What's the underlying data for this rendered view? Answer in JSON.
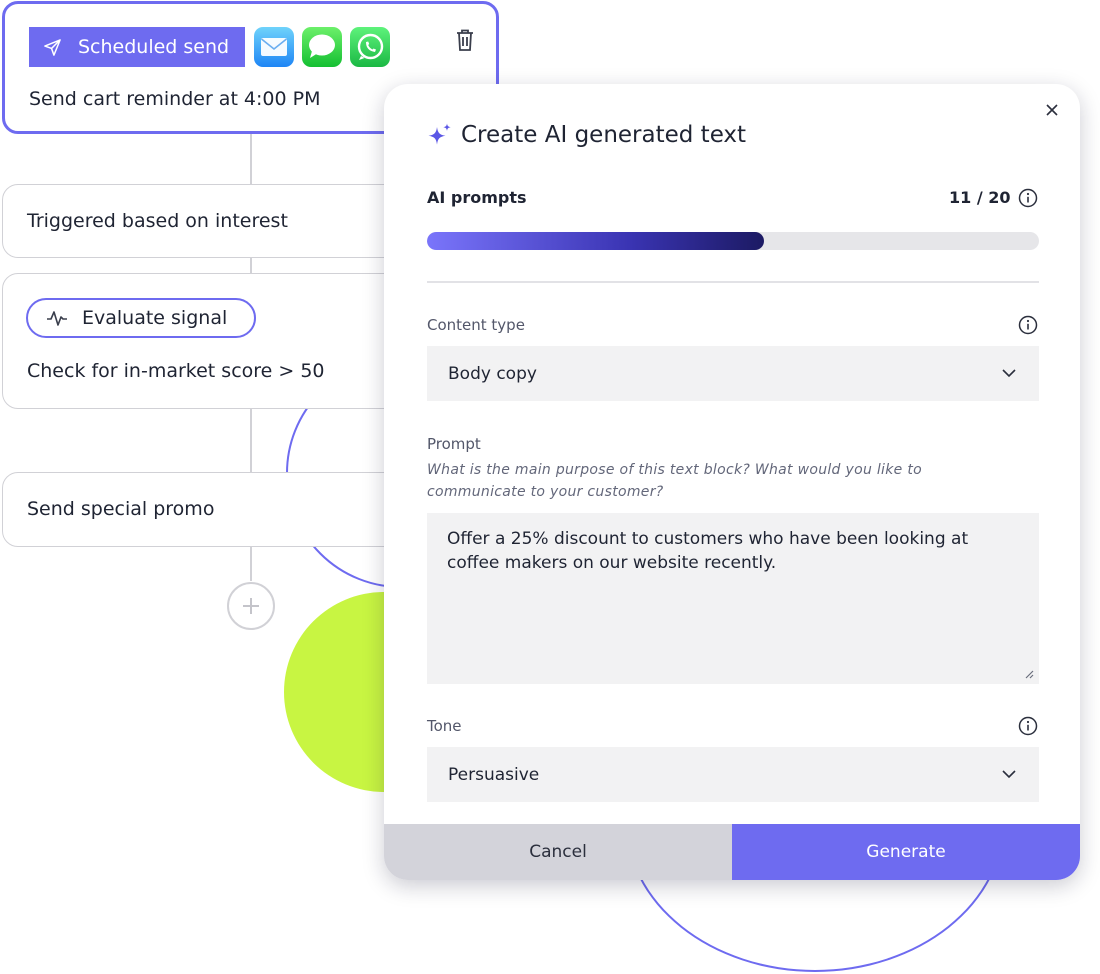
{
  "workflow": {
    "scheduled": {
      "chip_label": "Scheduled send",
      "text": "Send cart reminder at 4:00 PM",
      "channels": [
        "mail-icon",
        "messages-icon",
        "whatsapp-icon"
      ]
    },
    "triggered": {
      "text": "Triggered based on interest"
    },
    "evaluate": {
      "chip_label": "Evaluate signal",
      "text": "Check for in-market score > 50"
    },
    "promo": {
      "text": "Send special promo"
    },
    "add_step_icon": "plus-icon"
  },
  "modal": {
    "title": "Create AI generated text",
    "title_icon": "sparkle-icon",
    "prompts": {
      "label": "AI prompts",
      "count_text": "11 / 20",
      "used": 11,
      "total": 20
    },
    "content_type": {
      "label": "Content type",
      "selected": "Body copy"
    },
    "prompt": {
      "label": "Prompt",
      "help": "What is the main purpose of this text block? What would you like to communicate to your customer?",
      "value": "Offer a 25% discount to customers who have been looking at coffee makers on our website recently."
    },
    "tone": {
      "label": "Tone",
      "selected": "Persuasive"
    },
    "cancel_label": "Cancel",
    "generate_label": "Generate"
  },
  "colors": {
    "accent": "#6e6bf0",
    "lime": "#c8f542",
    "border": "#d1d1d6",
    "field_bg": "#f2f2f3"
  }
}
